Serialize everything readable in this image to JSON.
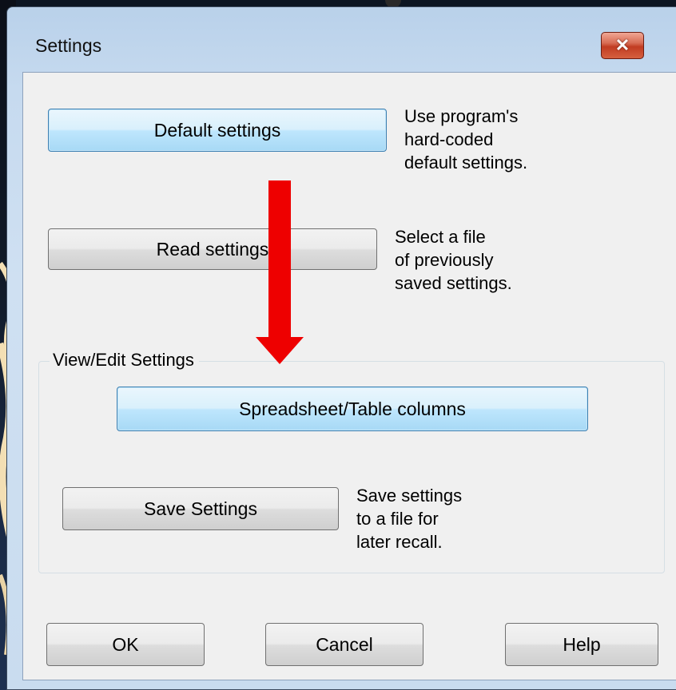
{
  "window": {
    "title": "Settings",
    "close_symbol": "✕"
  },
  "default_settings": {
    "button_label": "Default settings",
    "description": [
      "Use program's",
      "hard-coded",
      "default settings."
    ]
  },
  "read_settings": {
    "button_label": "Read settings",
    "description": [
      "Select a file",
      "of previously",
      "saved settings."
    ]
  },
  "view_edit": {
    "group_label": "View/Edit Settings",
    "spreadsheet_button_label": "Spreadsheet/Table columns"
  },
  "save_settings": {
    "button_label": "Save Settings",
    "description": [
      "Save settings",
      "to a file for",
      "later recall."
    ]
  },
  "footer": {
    "ok_label": "OK",
    "cancel_label": "Cancel",
    "help_label": "Help"
  },
  "colors": {
    "annotation_arrow": "#ee0000",
    "hot_button": "#bee6fd",
    "close_button": "#c13c22"
  }
}
